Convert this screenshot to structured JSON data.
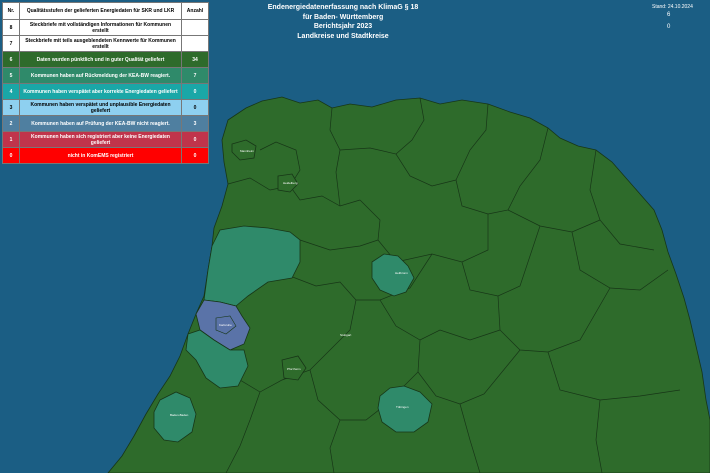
{
  "title": {
    "line1": "Endenergiedatenerfassung nach KlimaG § 18",
    "line2": "für Baden- Württemberg",
    "line3": "Berichtsjahr 2023",
    "line4": "Landkreise und Stadtkreise"
  },
  "stand": {
    "label": "Stand: 24.10.2024",
    "count1": "6",
    "count2": "0"
  },
  "legend": {
    "header_nr": "Nr.",
    "header_desc": "Qualitätsstufen der gelieferten Energiedaten für SKR und LKR",
    "header_count": "Anzahl",
    "rows": [
      {
        "nr": "8",
        "desc": "Steckbriefe mit vollständigen Informationen für Kommunen erstellt",
        "count": "",
        "bg": "#ffffff",
        "fg": "#000000"
      },
      {
        "nr": "7",
        "desc": "Steckbriefe mit teils ausgeblendeten Kennwerte für Kommunen erstellt",
        "count": "",
        "bg": "#ffffff",
        "fg": "#000000"
      },
      {
        "nr": "6",
        "desc": "Daten wurden pünktlich und in guter Qualität geliefert",
        "count": "34",
        "bg": "#2e6b2b",
        "fg": "#ffffff"
      },
      {
        "nr": "5",
        "desc": "Kommunen haben auf Rückmeldung der KEA-BW reagiert.",
        "count": "7",
        "bg": "#2f8a6a",
        "fg": "#ffffff"
      },
      {
        "nr": "4",
        "desc": "Kommunen haben verspätet aber korrekte Energiedaten geliefert",
        "count": "0",
        "bg": "#1aa7a7",
        "fg": "#ffffff"
      },
      {
        "nr": "3",
        "desc": "Kommunen haben verspätet und unplausible Energiedaten geliefert",
        "count": "0",
        "bg": "#8ed0f0",
        "fg": "#000000"
      },
      {
        "nr": "2",
        "desc": "Kommunen haben auf Prüfung der KEA-BW nicht reagiert.",
        "count": "3",
        "bg": "#4f7fa0",
        "fg": "#ffffff"
      },
      {
        "nr": "1",
        "desc": "Kommunen haben sich registriert aber keine Energiedaten geliefert",
        "count": "0",
        "bg": "#c0344b",
        "fg": "#ffffff"
      },
      {
        "nr": "0",
        "desc": "nicht in KomEMS registriert",
        "count": "0",
        "bg": "#ff0000",
        "fg": "#ffffff"
      }
    ]
  },
  "colors": {
    "sea": "#1b5e84",
    "level6": "#2e6b2b",
    "level5": "#2f8a6a",
    "level2": "#5a73a8",
    "border": "#173617"
  },
  "districts": {
    "d1": "Mannheim",
    "d2": "Heidelberg",
    "d3": "Heilbronn",
    "d4": "Karlsruhe",
    "d5": "Pforzheim",
    "d6": "Stuttgart",
    "d7": "Baden-Baden",
    "d8": "Tübingen"
  }
}
